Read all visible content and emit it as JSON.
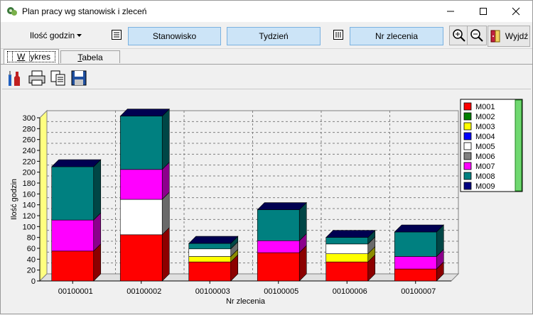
{
  "window": {
    "title": "Plan pracy wg stanowisk i zleceń"
  },
  "toolbar": {
    "dropdown_label": "Ilość godzin",
    "btn_stanowisko": "Stanowisko",
    "btn_tydzien": "Tydzień",
    "btn_nr_zlecenia": "Nr zlecenia",
    "exit_label": "Wyjdź"
  },
  "tabs": [
    {
      "label": "Wykres",
      "active": true
    },
    {
      "label": "Tabela",
      "active": false
    }
  ],
  "colors": {
    "M001": "#ff0000",
    "M002": "#008000",
    "M003": "#ffff00",
    "M004": "#0000ff",
    "M005": "#ffffff",
    "M006": "#808080",
    "M007": "#ff00ff",
    "M008": "#008080",
    "M009": "#000080"
  },
  "chart_data": {
    "type": "bar",
    "stacked": true,
    "categories": [
      "00100001",
      "00100002",
      "00100003",
      "00100005",
      "00100006",
      "00100007"
    ],
    "xlabel": "Nr zlecenia",
    "ylabel": "Ilość godzin",
    "ylim": [
      0,
      300
    ],
    "yticks": [
      0,
      20,
      40,
      60,
      80,
      100,
      120,
      140,
      160,
      180,
      200,
      220,
      240,
      260,
      280,
      300
    ],
    "grid": true,
    "legend": [
      "M001",
      "M002",
      "M003",
      "M004",
      "M005",
      "M006",
      "M007",
      "M008",
      "M009"
    ],
    "legend_position": "right",
    "series": [
      {
        "name": "M001",
        "values": [
          55,
          85,
          35,
          52,
          35,
          22
        ]
      },
      {
        "name": "M003",
        "values": [
          0,
          0,
          10,
          0,
          15,
          0
        ]
      },
      {
        "name": "M005",
        "values": [
          0,
          65,
          14,
          0,
          18,
          0
        ]
      },
      {
        "name": "M007",
        "values": [
          57,
          55,
          0,
          22,
          0,
          23
        ]
      },
      {
        "name": "M008",
        "values": [
          98,
          98,
          10,
          57,
          12,
          45
        ]
      }
    ]
  }
}
